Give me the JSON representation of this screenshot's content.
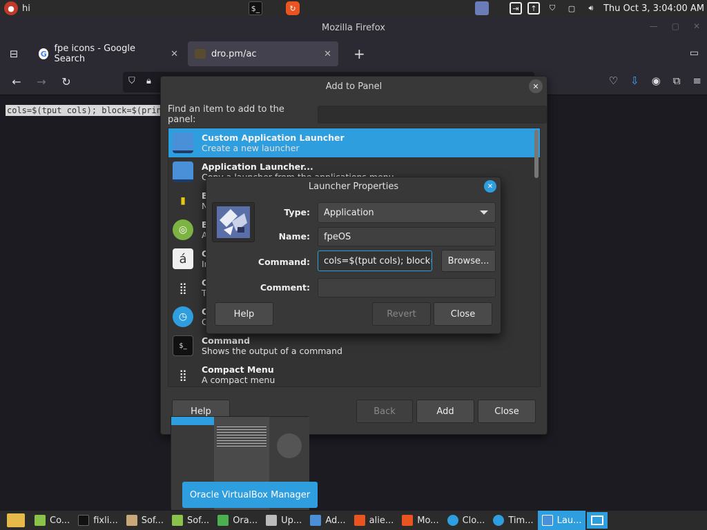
{
  "top_panel": {
    "app_label": "hi",
    "clock": "Thu Oct  3,  3:04:00 AM"
  },
  "firefox": {
    "window_title": "Mozilla Firefox",
    "tabs": [
      {
        "label": "fpe icons - Google Search"
      },
      {
        "label": "dro.pm/ac"
      }
    ],
    "page_text": "cols=$(tput cols); block=$(prin"
  },
  "add_panel": {
    "title": "Add to Panel",
    "find_label": "Find an item to add to the panel:",
    "items": [
      {
        "title": "Custom Application Launcher",
        "desc": "Create a new launcher"
      },
      {
        "title": "Application Launcher...",
        "desc": "Copy a launcher from the applications menu"
      },
      {
        "title": "B",
        "desc": "N"
      },
      {
        "title": "B",
        "desc": "A"
      },
      {
        "title": "C",
        "desc": "In"
      },
      {
        "title": "C",
        "desc": "T"
      },
      {
        "title": "C",
        "desc": "C"
      },
      {
        "title": "Command",
        "desc": "Shows the output of a command"
      },
      {
        "title": "Compact Menu",
        "desc": "A compact menu"
      }
    ],
    "buttons": {
      "help": "Help",
      "back": "Back",
      "add": "Add",
      "close": "Close"
    }
  },
  "launcher": {
    "title": "Launcher Properties",
    "labels": {
      "type": "Type:",
      "name": "Name:",
      "command": "Command:",
      "comment": "Comment:"
    },
    "type_value": "Application",
    "name_value": "fpeOS",
    "command_value": "cols=$(tput cols); block=$",
    "comment_value": "",
    "buttons": {
      "browse": "Browse...",
      "help": "Help",
      "revert": "Revert",
      "close": "Close"
    }
  },
  "tooltip": "Oracle VirtualBox Manager",
  "taskbar": [
    {
      "label": "Co..."
    },
    {
      "label": "fixli..."
    },
    {
      "label": "Sof..."
    },
    {
      "label": "Sof..."
    },
    {
      "label": "Ora..."
    },
    {
      "label": "Up..."
    },
    {
      "label": "Ad..."
    },
    {
      "label": "alie..."
    },
    {
      "label": "Mo..."
    },
    {
      "label": "Clo..."
    },
    {
      "label": "Tim..."
    },
    {
      "label": "Lau..."
    }
  ]
}
